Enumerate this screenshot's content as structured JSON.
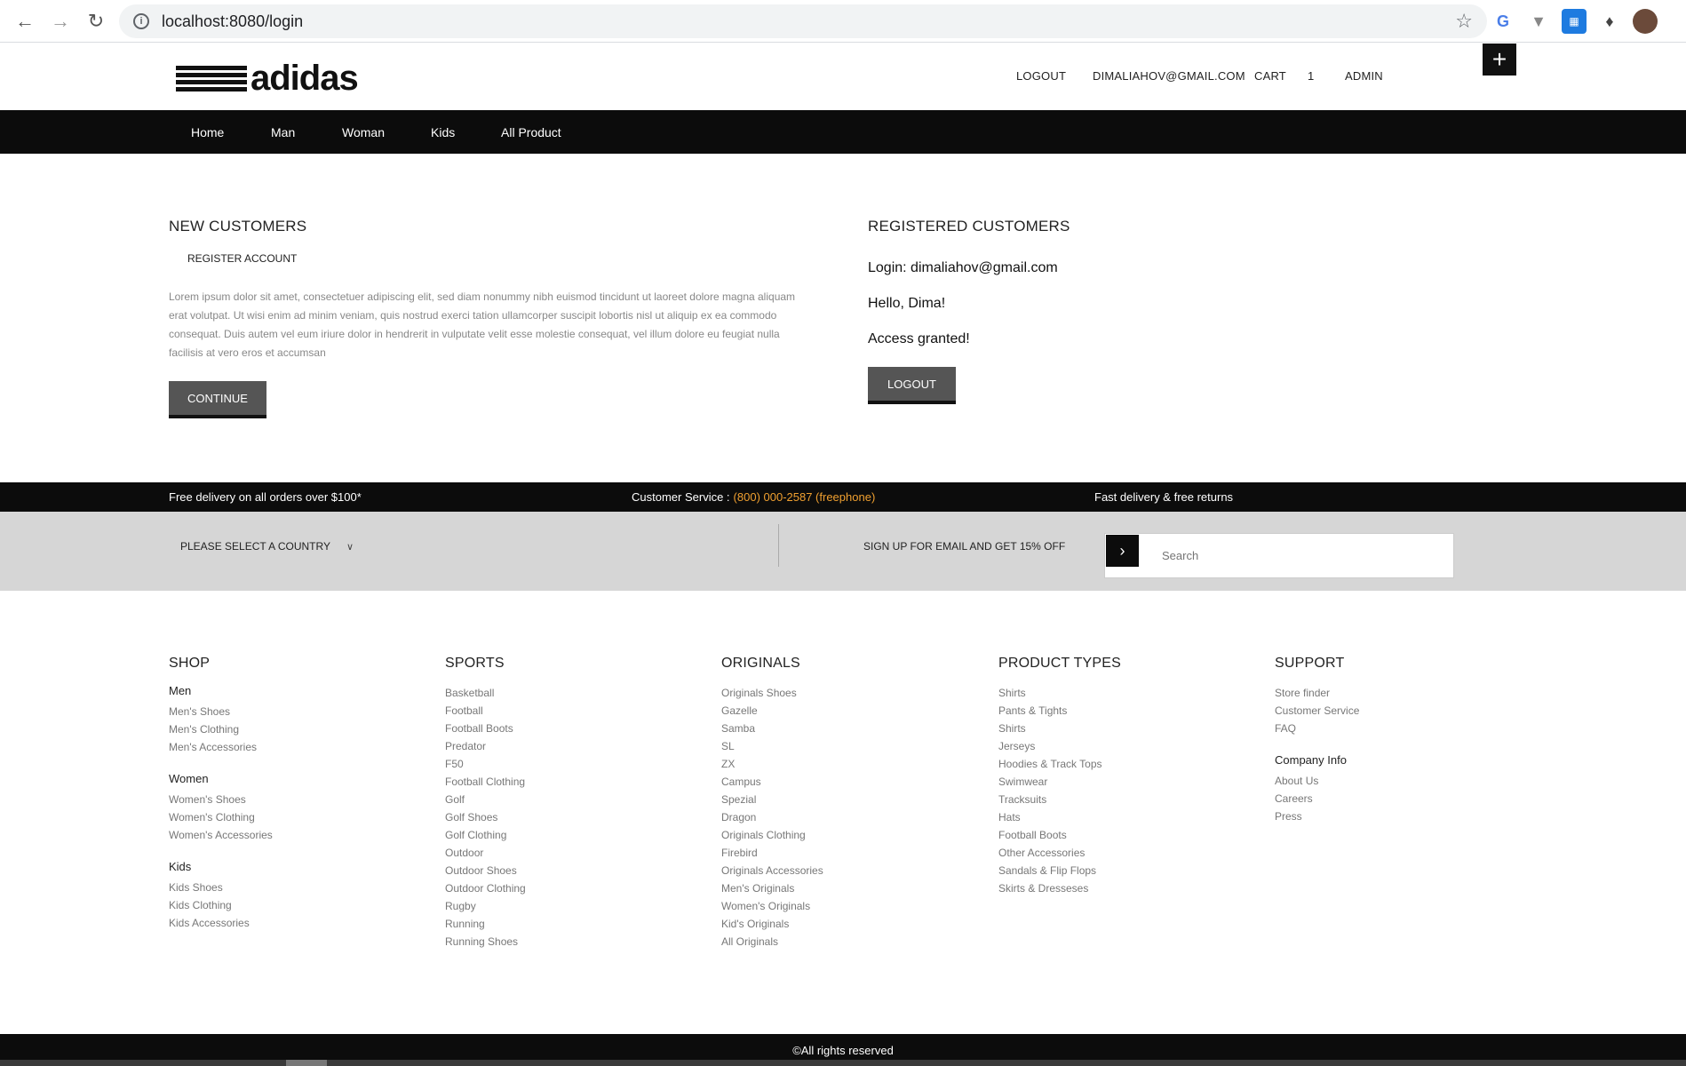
{
  "browser": {
    "url": "localhost:8080/login"
  },
  "header": {
    "logo_text": "adidas",
    "nav": [
      "LOGOUT",
      "DIMALIAHOV@GMAIL.COM",
      "CART",
      "1",
      "ADMIN"
    ],
    "plus": "+"
  },
  "menu": [
    "Home",
    "Man",
    "Woman",
    "Kids",
    "All Product"
  ],
  "new_customers": {
    "title": "NEW CUSTOMERS",
    "register_link": "REGISTER ACCOUNT",
    "text": "Lorem ipsum dolor sit amet, consectetuer adipiscing elit, sed diam nonummy nibh euismod tincidunt ut laoreet dolore magna aliquam erat volutpat. Ut wisi enim ad minim veniam, quis nostrud exerci tation ullamcorper suscipit lobortis nisl ut aliquip ex ea commodo consequat. Duis autem vel eum iriure dolor in hendrerit in vulputate velit esse molestie consequat, vel illum dolore eu feugiat nulla facilisis at vero eros et accumsan",
    "button": "CONTINUE"
  },
  "registered": {
    "title": "REGISTERED CUSTOMERS",
    "login": "Login: dimaliahov@gmail.com",
    "hello": "Hello, Dima!",
    "access": "Access granted!",
    "button": "LOGOUT"
  },
  "info_bar": {
    "delivery": "Free delivery on all orders over $100*",
    "service_label": "Customer Service :",
    "service_phone": "(800) 000-2587 (freephone)",
    "returns": "Fast delivery & free returns"
  },
  "newsletter": {
    "country": "PLEASE SELECT A COUNTRY",
    "signup": "SIGN UP FOR EMAIL AND GET 15% OFF",
    "placeholder": "Search"
  },
  "footer": {
    "shop": {
      "title": "SHOP",
      "groups": [
        {
          "name": "Men",
          "links": [
            "Men's Shoes",
            "Men's Clothing",
            "Men's Accessories"
          ]
        },
        {
          "name": "Women",
          "links": [
            "Women's Shoes",
            "Women's Clothing",
            "Women's Accessories"
          ]
        },
        {
          "name": "Kids",
          "links": [
            "Kids Shoes",
            "Kids Clothing",
            "Kids Accessories"
          ]
        }
      ]
    },
    "sports": {
      "title": "SPORTS",
      "links": [
        "Basketball",
        "Football",
        "Football Boots",
        "Predator",
        "F50",
        "Football Clothing",
        "Golf",
        "Golf Shoes",
        "Golf Clothing",
        "Outdoor",
        "Outdoor Shoes",
        "Outdoor Clothing",
        "Rugby",
        "Running",
        "Running Shoes"
      ]
    },
    "originals": {
      "title": "ORIGINALS",
      "links": [
        "Originals Shoes",
        "Gazelle",
        "Samba",
        "SL",
        "ZX",
        "Campus",
        "Spezial",
        "Dragon",
        "Originals Clothing",
        "Firebird",
        "Originals Accessories",
        "Men's Originals",
        "Women's Originals",
        "Kid's Originals",
        "All Originals"
      ]
    },
    "product_types": {
      "title": "PRODUCT TYPES",
      "links": [
        "Shirts",
        "Pants & Tights",
        "Shirts",
        "Jerseys",
        "Hoodies & Track Tops",
        "Swimwear",
        "Tracksuits",
        "Hats",
        "Football Boots",
        "Other Accessories",
        "Sandals & Flip Flops",
        "Skirts & Dresseses"
      ]
    },
    "support": {
      "title": "SUPPORT",
      "links": [
        "Store finder",
        "Customer Service",
        "FAQ"
      ],
      "company_title": "Company Info",
      "company_links": [
        "About Us",
        "Careers",
        "Press"
      ]
    }
  },
  "copyright": "©All rights reserved"
}
